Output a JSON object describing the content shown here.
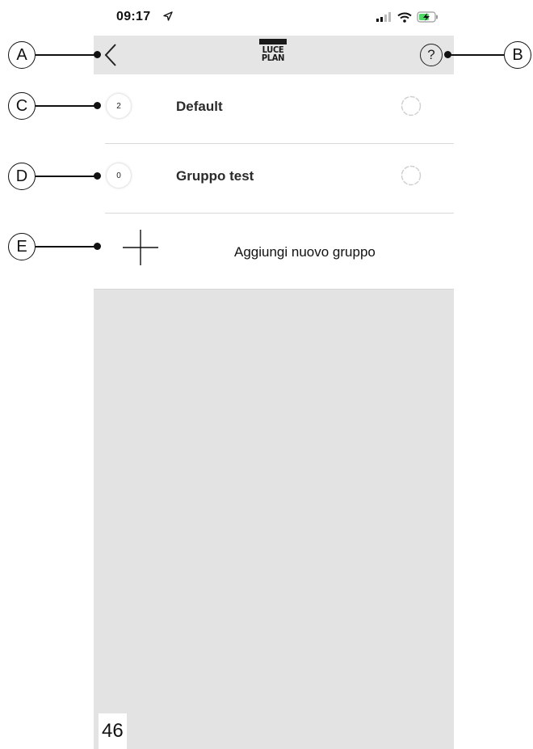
{
  "status_bar": {
    "time": "09:17"
  },
  "nav": {
    "logo_line1": "LUCE",
    "logo_line2": "PLAN",
    "help_symbol": "?"
  },
  "groups": [
    {
      "count": "2",
      "name": "Default"
    },
    {
      "count": "0",
      "name": "Gruppo test"
    }
  ],
  "add_group": {
    "label": "Aggiungi nuovo gruppo"
  },
  "page_number": "46",
  "callouts": {
    "a": "A",
    "b": "B",
    "c": "C",
    "d": "D",
    "e": "E"
  },
  "icons": {
    "back": "chevron-left-icon",
    "help": "question-circle-icon",
    "settings": "gear-icon",
    "add": "plus-icon"
  },
  "colors": {
    "navbar_bg": "#e5e5e5",
    "empty_area_bg": "#e3e3e3",
    "text": "#222222"
  }
}
